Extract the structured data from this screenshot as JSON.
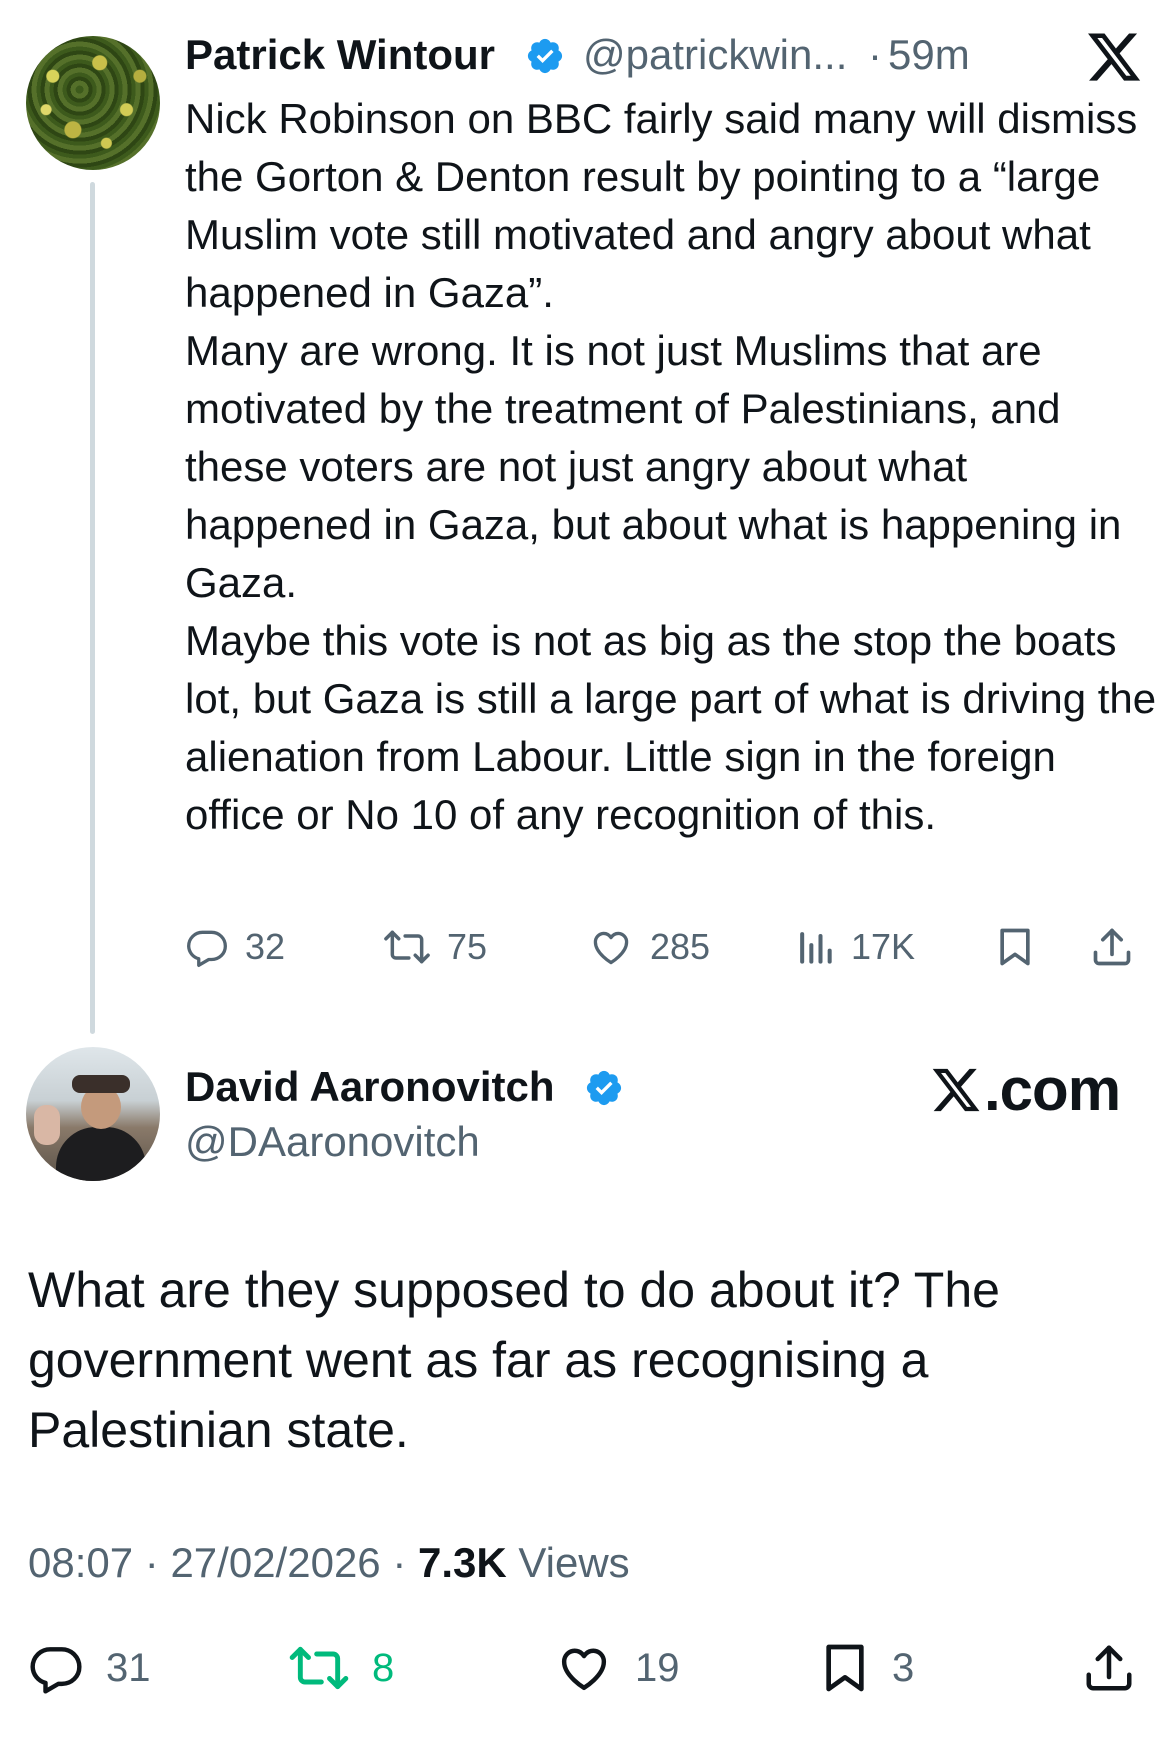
{
  "parent_tweet": {
    "author_name": "Patrick Wintour",
    "handle": "@patrickwin...",
    "separator": "·",
    "time": "59m",
    "text_paragraphs": [
      "Nick Robinson on BBC fairly said many will dismiss the Gorton & Denton result by pointing to a “large Muslim vote still motivated and angry about what happened in Gaza”.",
      "Many are wrong. It is not just Muslims that are motivated by the treatment of Palestinians, and these voters are not just angry about what happened in Gaza, but about what is happening in Gaza.",
      "Maybe this vote is not as big as the stop the boats lot,  but Gaza is still a large part of what is driving the alienation from Labour. Little sign in the foreign office or No 10 of any recognition of this."
    ],
    "stats": {
      "replies": "32",
      "reposts": "75",
      "likes": "285",
      "views": "17K"
    }
  },
  "reply_tweet": {
    "author_name": "David Aaronovitch",
    "handle": "@DAaronovitch",
    "brand_label": ".com",
    "text": "What are they supposed to do about it? The government went as far as recognising a Palestinian state.",
    "meta": {
      "time": "08:07",
      "separator": "·",
      "date": "27/02/2026",
      "views_count": "7.3K",
      "views_label": "Views"
    },
    "stats": {
      "replies": "31",
      "reposts": "8",
      "likes": "19",
      "bookmarks": "3"
    }
  },
  "icons": {
    "verified": "verified-badge-icon",
    "reply": "reply-bubble-icon",
    "repost": "repost-icon",
    "like": "heart-icon",
    "views": "bar-chart-icon",
    "bookmark": "bookmark-icon",
    "share": "share-icon",
    "brand": "x-logo-icon"
  },
  "colors": {
    "verified_blue": "#1d9bf0",
    "text_primary": "#0f1419",
    "text_secondary": "#536471",
    "repost_green": "#00ba7c",
    "thread_line": "#cfd9de"
  }
}
